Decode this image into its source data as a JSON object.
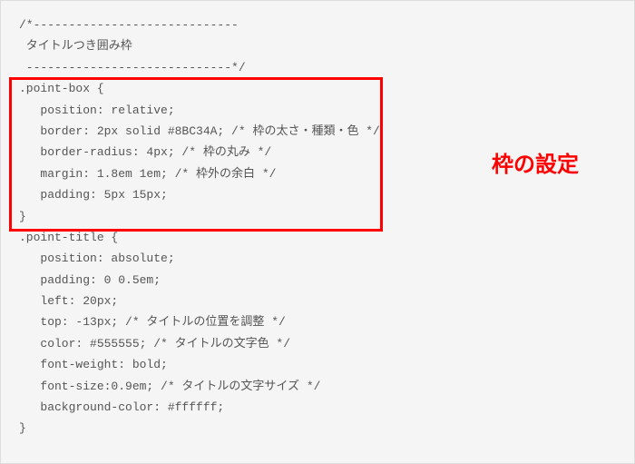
{
  "code": {
    "lines": [
      "/*-----------------------------",
      " タイトルつき囲み枠",
      " -----------------------------*/",
      ".point-box {",
      "   position: relative;",
      "   border: 2px solid #8BC34A; /* 枠の太さ・種類・色 */",
      "   border-radius: 4px; /* 枠の丸み */",
      "   margin: 1.8em 1em; /* 枠外の余白 */",
      "   padding: 5px 15px;",
      "}",
      "",
      ".point-title {",
      "   position: absolute;",
      "   padding: 0 0.5em;",
      "   left: 20px;",
      "   top: -13px; /* タイトルの位置を調整 */",
      "   color: #555555; /* タイトルの文字色 */",
      "   font-weight: bold;",
      "   font-size:0.9em; /* タイトルの文字サイズ */",
      "   background-color: #ffffff;",
      "}"
    ]
  },
  "annotation": {
    "text": "枠の設定"
  }
}
